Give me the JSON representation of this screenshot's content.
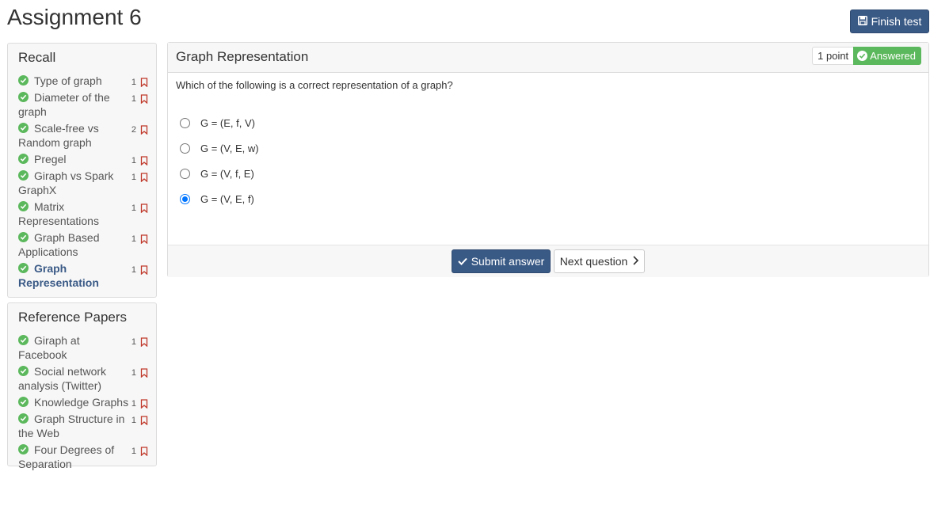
{
  "page": {
    "title": "Assignment 6"
  },
  "toolbar": {
    "finish_label": "Finish test"
  },
  "recall": {
    "heading": "Recall",
    "items": [
      {
        "label": "Type of graph",
        "points": "1",
        "active": false
      },
      {
        "label": "Diameter of the graph",
        "points": "1",
        "active": false
      },
      {
        "label": "Scale-free vs Random graph",
        "points": "2",
        "active": false
      },
      {
        "label": "Pregel",
        "points": "1",
        "active": false
      },
      {
        "label": "Giraph vs Spark GraphX",
        "points": "1",
        "active": false
      },
      {
        "label": "Matrix Representations",
        "points": "1",
        "active": false
      },
      {
        "label": "Graph Based Applications",
        "points": "1",
        "active": false
      },
      {
        "label": "Graph Representation",
        "points": "1",
        "active": true
      }
    ]
  },
  "references": {
    "heading": "Reference Papers",
    "items": [
      {
        "label": "Giraph at Facebook",
        "points": "1"
      },
      {
        "label": "Social network analysis (Twitter)",
        "points": "1"
      },
      {
        "label": "Knowledge Graphs",
        "points": "1"
      },
      {
        "label": "Graph Structure in the Web",
        "points": "1"
      },
      {
        "label": "Four Degrees of Separation",
        "points": "1"
      }
    ]
  },
  "question": {
    "title": "Graph Representation",
    "points_badge": "1 point",
    "status_badge": "Answered",
    "text": "Which of the following is a correct representation of a graph?",
    "options": [
      {
        "label": "G = (E, f, V)",
        "checked": false
      },
      {
        "label": "G = (V, E, w)",
        "checked": false
      },
      {
        "label": "G = (V, f, E)",
        "checked": false
      },
      {
        "label": "G = (V, E, f)",
        "checked": true
      }
    ],
    "submit_label": "Submit answer",
    "next_label": "Next question"
  },
  "colors": {
    "primary": "#3a5a86",
    "success": "#5cb85c",
    "bookmark": "#c0392b",
    "radio_checked": "#0075ff"
  },
  "icons": {
    "finish": "save-icon",
    "item_status": "check-circle-icon",
    "item_flag": "bookmark-icon",
    "answered": "check-circle-icon",
    "submit": "checkmark-icon",
    "next": "chevron-right-icon"
  }
}
